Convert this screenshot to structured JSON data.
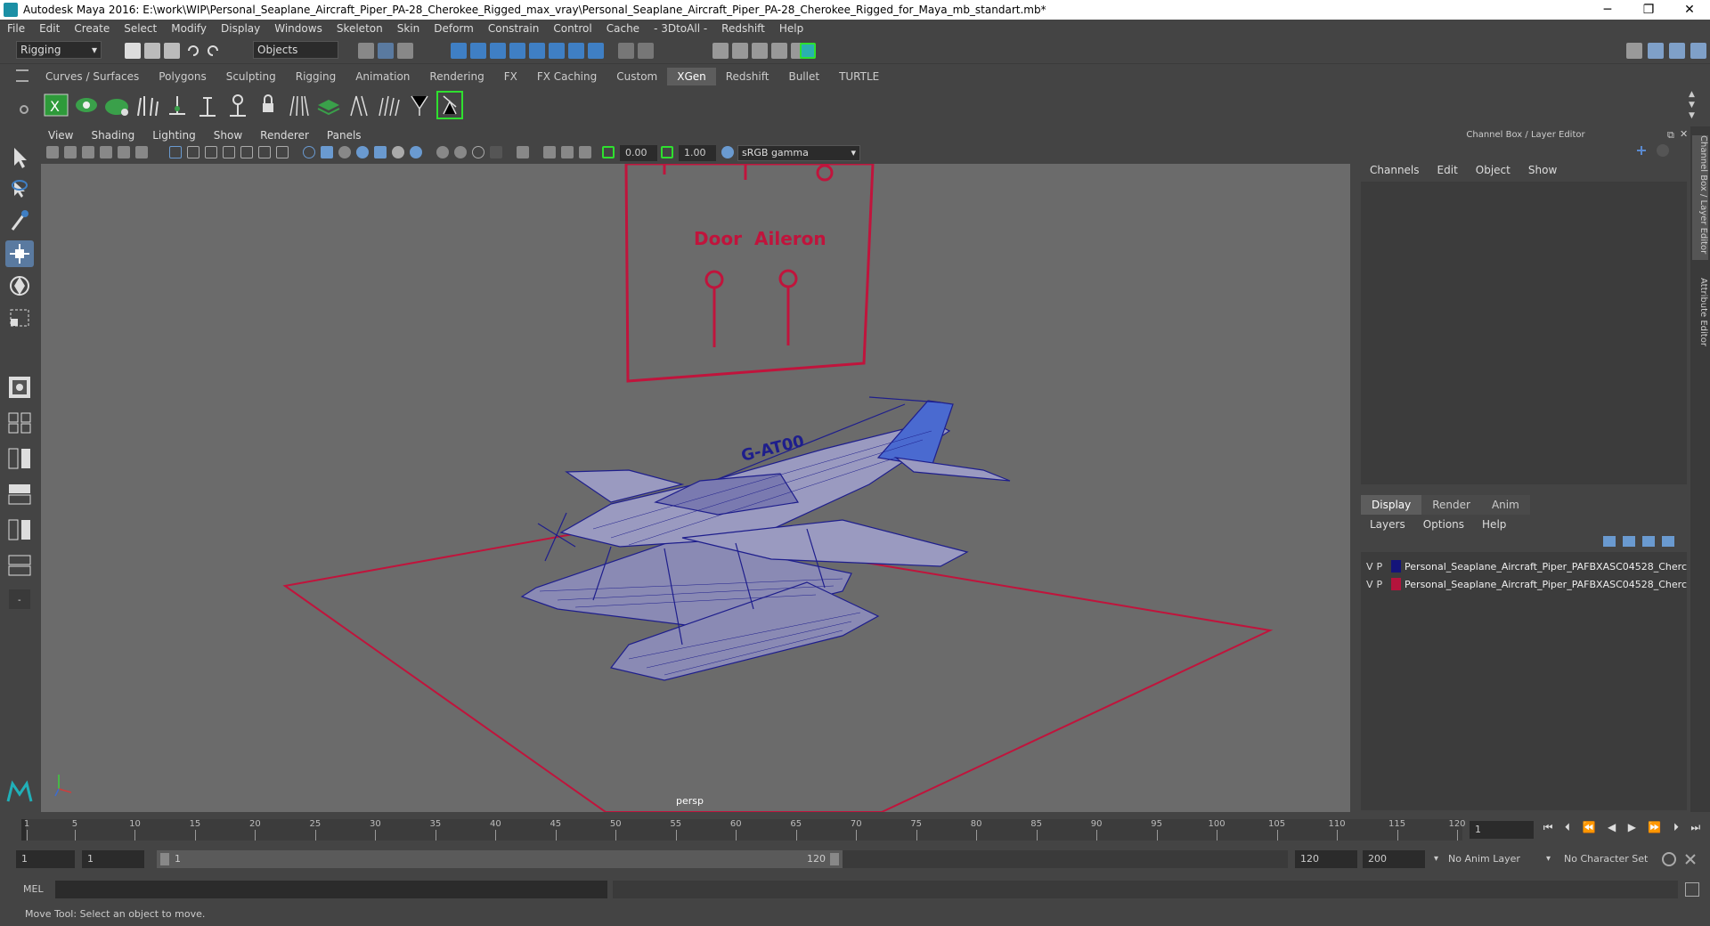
{
  "window": {
    "title": "Autodesk Maya 2016: E:\\work\\WIP\\Personal_Seaplane_Aircraft_Piper_PA-28_Cherokee_Rigged_max_vray\\Personal_Seaplane_Aircraft_Piper_PA-28_Cherokee_Rigged_for_Maya_mb_standart.mb*",
    "minimize": "─",
    "maximize": "❐",
    "close": "✕"
  },
  "menubar": [
    "File",
    "Edit",
    "Create",
    "Select",
    "Modify",
    "Display",
    "Windows",
    "Skeleton",
    "Skin",
    "Deform",
    "Constrain",
    "Control",
    "Cache",
    "- 3DtoAll -",
    "Redshift",
    "Help"
  ],
  "toolbar": {
    "mode": "Rigging",
    "selection_mask": "Objects"
  },
  "shelf_tabs": [
    "Curves / Surfaces",
    "Polygons",
    "Sculpting",
    "Rigging",
    "Animation",
    "Rendering",
    "FX",
    "FX Caching",
    "Custom",
    "XGen",
    "Redshift",
    "Bullet",
    "TURTLE"
  ],
  "shelf_active": "XGen",
  "viewport": {
    "menu": [
      "View",
      "Shading",
      "Lighting",
      "Show",
      "Renderer",
      "Panels"
    ],
    "exposure": "0.00",
    "gamma": "1.00",
    "color_space": "sRGB gamma",
    "camera_label": "persp",
    "board_labels": [
      "Door",
      "Aileron"
    ],
    "tail_number": "G-AT00",
    "colors": {
      "wire": "#1e1e8c",
      "rig": "#c0143c",
      "background": "#6b6b6b"
    }
  },
  "channel_box": {
    "title": "Channel Box / Layer Editor",
    "menu": [
      "Channels",
      "Edit",
      "Object",
      "Show"
    ]
  },
  "layer_editor": {
    "tabs": [
      "Display",
      "Render",
      "Anim"
    ],
    "active_tab": "Display",
    "menu": [
      "Layers",
      "Options",
      "Help"
    ],
    "layers": [
      {
        "v": "V",
        "p": "P",
        "color": "#14147a",
        "name": "Personal_Seaplane_Aircraft_Piper_PAFBXASC04528_Cherc"
      },
      {
        "v": "V",
        "p": "P",
        "color": "#b4143c",
        "name": "Personal_Seaplane_Aircraft_Piper_PAFBXASC04528_Cherc"
      }
    ]
  },
  "side_tabs": [
    "Channel Box / Layer Editor",
    "Attribute Editor"
  ],
  "timeline": {
    "ticks": [
      "1",
      "5",
      "10",
      "15",
      "20",
      "25",
      "30",
      "35",
      "40",
      "45",
      "50",
      "55",
      "60",
      "65",
      "70",
      "75",
      "80",
      "85",
      "90",
      "95",
      "100",
      "105",
      "110",
      "115",
      "120"
    ],
    "current_frame": "1"
  },
  "range": {
    "start": "1",
    "playback_start": "1",
    "slider_start": "1",
    "slider_end": "120",
    "playback_end": "120",
    "end": "200",
    "anim_layer": "No Anim Layer",
    "character_set": "No Character Set"
  },
  "command_line": {
    "label": "MEL"
  },
  "help_line": "Move Tool: Select an object to move."
}
